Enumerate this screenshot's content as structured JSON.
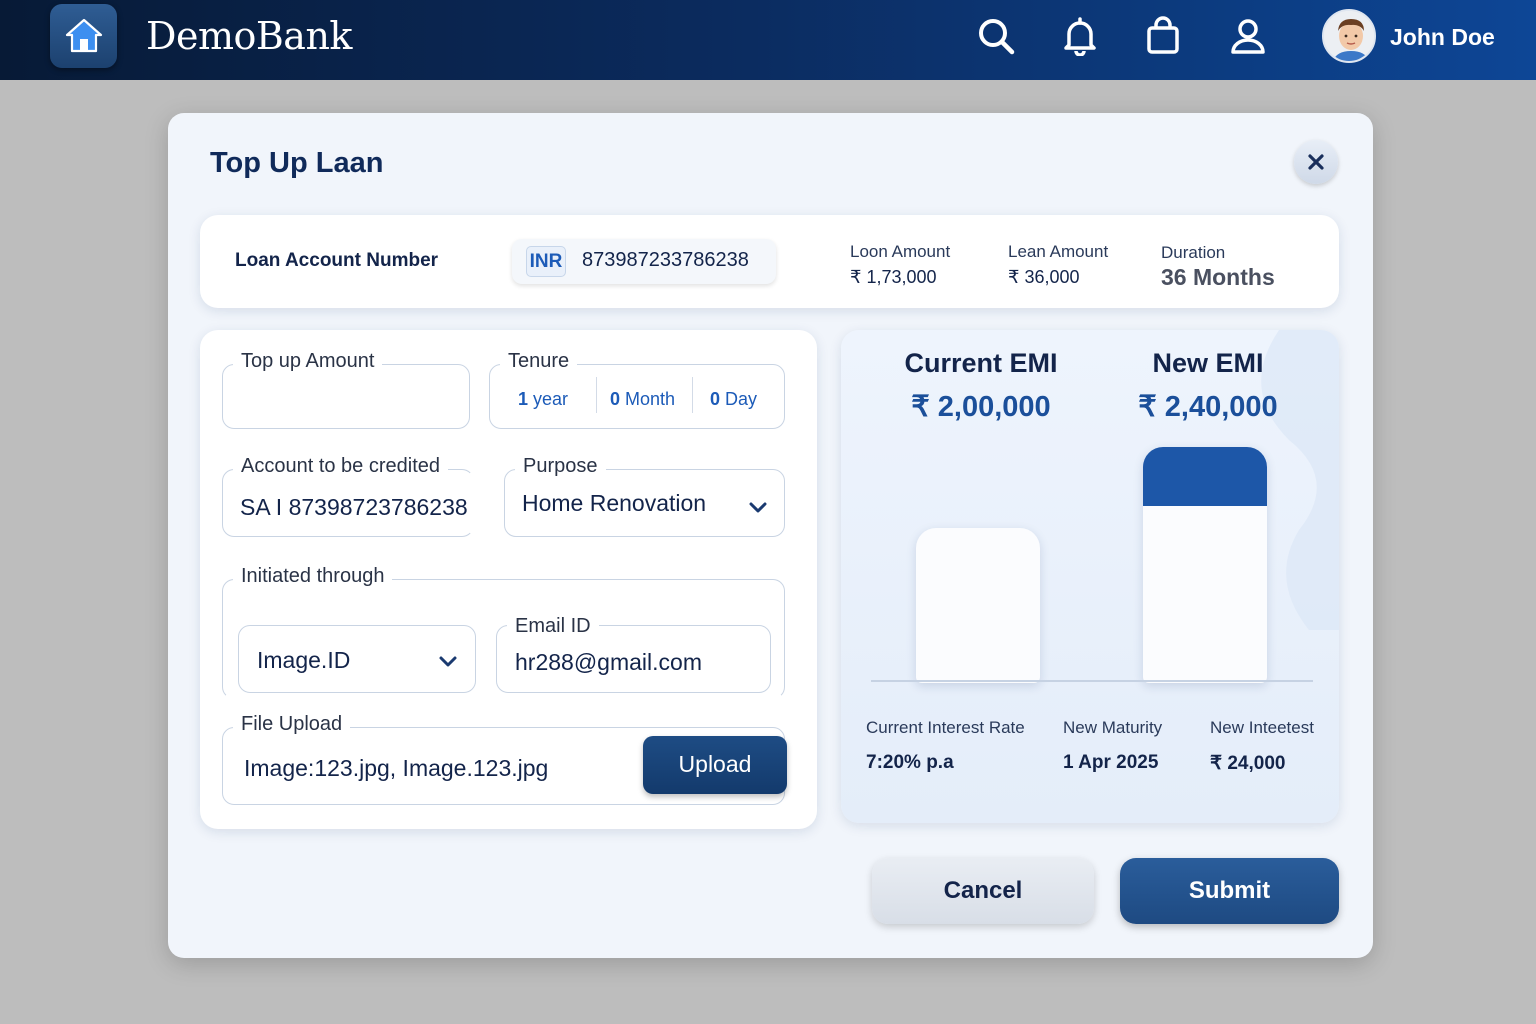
{
  "topbar": {
    "brand": "DemoBank",
    "icons": [
      "home-icon",
      "search-icon",
      "bell-icon",
      "shopping-bag-icon",
      "user-icon"
    ],
    "username": "John Doe"
  },
  "modal": {
    "title": "Top Up Laan",
    "close_icon": "close-icon"
  },
  "loan_info": {
    "account_label": "Loan Account Number",
    "currency_badge": "INR",
    "account_number": "873987233786238",
    "stats": [
      {
        "label": "Loon Amount",
        "value": "₹ 1,73,000"
      },
      {
        "label": "Lean Amount",
        "value": "₹ 36,000"
      },
      {
        "label": "Duration",
        "value": "36 Months"
      }
    ]
  },
  "form": {
    "topup_amount": {
      "label": "Top up Amount",
      "value": ""
    },
    "tenure": {
      "label": "Tenure",
      "year_num": "1",
      "year_unit": "year",
      "month_num": "0",
      "month_unit": "Month",
      "day_num": "0",
      "day_unit": "Day"
    },
    "account_credited": {
      "label": "Account to be credited",
      "value": "SA I 87398723786238"
    },
    "purpose": {
      "label": "Purpose",
      "value": "Home Renovation"
    },
    "initiated_through": {
      "label": "Initiated through",
      "select_value": "Image.ID",
      "email_label": "Email ID",
      "email_value": "hr288@gmail.com"
    },
    "file_upload": {
      "label": "File Upload",
      "value": "Image:123.jpg, Image.123.jpg",
      "button": "Upload"
    }
  },
  "emi": {
    "current": {
      "title": "Current EMI",
      "value": "₹ 2,00,000"
    },
    "new": {
      "title": "New EMI",
      "value": "₹ 2,40,000"
    },
    "chart_data": {
      "type": "bar",
      "categories": [
        "Current EMI",
        "New EMI"
      ],
      "values": [
        200000,
        240000
      ],
      "new_highlight_fraction": 0.25,
      "colors": {
        "bar": "#fbfcfe",
        "highlight": "#1d57a8"
      }
    },
    "stats": [
      {
        "label": "Current Interest Rate",
        "value": "7:20% p.a"
      },
      {
        "label": "New Maturity",
        "value": "1 Apr 2025"
      },
      {
        "label": "New Inteetest",
        "value": "₹ 24,000"
      }
    ]
  },
  "actions": {
    "cancel": "Cancel",
    "submit": "Submit"
  },
  "colors": {
    "primary": "#1d57a8",
    "navy": "#13244a",
    "topbar_start": "#071a36",
    "topbar_end": "#0d4696"
  }
}
